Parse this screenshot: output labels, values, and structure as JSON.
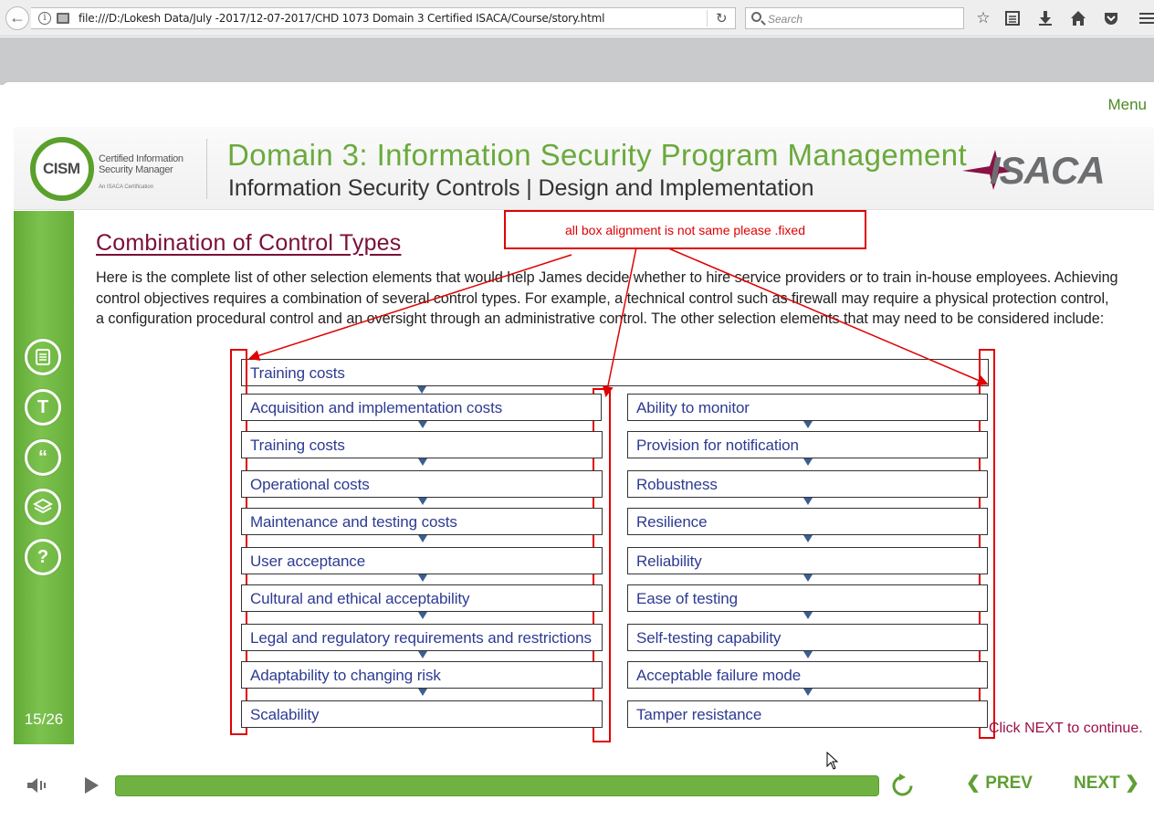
{
  "browser": {
    "url": "file:///D:/Lokesh Data/July -2017/12-07-2017/CHD 1073 Domain 3 Certified ISACA/Course/story.html",
    "search_placeholder": "Search"
  },
  "player": {
    "menu_label": "Menu",
    "slide_counter": "15/26",
    "prev_label": "PREV",
    "next_label": "NEXT",
    "progress_fraction": 1.0,
    "sidebar_icons": [
      "notes-icon",
      "transcript-icon",
      "quote-icon",
      "layers-icon",
      "help-icon"
    ]
  },
  "header": {
    "logo_left_text": "CISM",
    "logo_left_sub": "Certified Information Security Manager",
    "logo_left_sub2": "An ISACA Certification",
    "title": "Domain 3: Information Security Program Management",
    "subtitle": "Information Security Controls | Design and Implementation",
    "logo_right_text": "ISACA"
  },
  "slide": {
    "title": "Combination of Control Types",
    "intro": "Here is the complete list of other selection elements that would help James decide whether to hire service providers or to train in-house employees. Achieving control objectives requires a combination of several control types. For example, a technical control such as firewall may require a physical protection control, a configuration procedural control and an oversight through an administrative control. The other selection elements that may need to be considered include:",
    "top_item": "Training costs",
    "left_items": [
      "Acquisition and implementation costs",
      "Training costs",
      "Operational costs",
      "Maintenance and testing costs",
      "User acceptance",
      "Cultural and ethical acceptability",
      "Legal and regulatory requirements and restrictions",
      "Adaptability to changing risk",
      "Scalability"
    ],
    "right_items": [
      "Ability to monitor",
      "Provision for notification",
      "Robustness",
      "Resilience",
      "Reliability",
      "Ease of testing",
      "Self-testing capability",
      "Acceptable failure mode",
      "Tamper resistance"
    ],
    "continue_text": "Click NEXT to continue."
  },
  "annotation": {
    "note": "all box alignment is not same please .fixed",
    "color": "#e00000"
  },
  "colors": {
    "green": "#6aaa3c",
    "title_maroon": "#7a1038",
    "item_blue": "#2d3b92"
  }
}
